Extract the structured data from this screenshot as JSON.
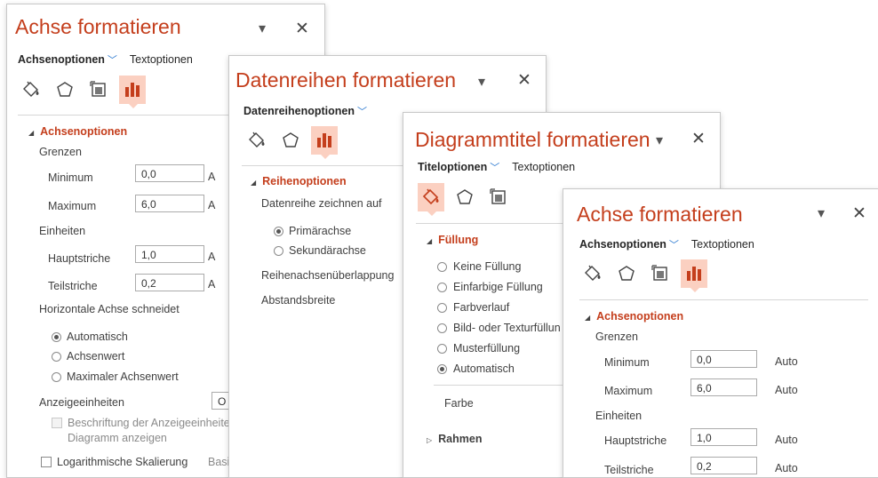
{
  "p1": {
    "title": "Achse formatieren",
    "tab_active": "Achsenoptionen",
    "tab_other": "Textoptionen",
    "section": "Achsenoptionen",
    "grenzen": "Grenzen",
    "minimum_label": "Minimum",
    "minimum_value": "0,0",
    "maximum_label": "Maximum",
    "maximum_value": "6,0",
    "auto_cut": "A",
    "einheiten": "Einheiten",
    "haupt_label": "Hauptstriche",
    "haupt_value": "1,0",
    "teil_label": "Teilstriche",
    "teil_value": "0,2",
    "schneidet": "Horizontale Achse schneidet",
    "radio_auto": "Automatisch",
    "radio_wert": "Achsenwert",
    "radio_max": "Maximaler Achsenwert",
    "anzeige": "Anzeigeeinheiten",
    "anzeige_value": "O",
    "beschriftung_1": "Beschriftung der Anzeigeeinheite",
    "beschriftung_2": "Diagramm anzeigen",
    "log": "Logarithmische Skalierung",
    "basis": "Basis"
  },
  "p2": {
    "title": "Datenreihen formatieren",
    "tab_active": "Datenreihenoptionen",
    "section": "Reihenoptionen",
    "zeichnen": "Datenreihe zeichnen auf",
    "primaer": "Primärachse",
    "sekundaer": "Sekundärachse",
    "ueberlappung": "Reihenachsenüberlappung",
    "abstand": "Abstandsbreite"
  },
  "p3": {
    "title": "Diagrammtitel formatieren",
    "tab_active": "Titeloptionen",
    "tab_other": "Textoptionen",
    "fuellung": "Füllung",
    "keine": "Keine Füllung",
    "einfarbig": "Einfarbige Füllung",
    "verlauf": "Farbverlauf",
    "bild": "Bild- oder Texturfüllun",
    "muster": "Musterfüllung",
    "automatisch": "Automatisch",
    "farbe": "Farbe",
    "rahmen": "Rahmen"
  },
  "p4": {
    "title": "Achse formatieren",
    "tab_active": "Achsenoptionen",
    "tab_other": "Textoptionen",
    "section": "Achsenoptionen",
    "grenzen": "Grenzen",
    "minimum_label": "Minimum",
    "minimum_value": "0,0",
    "maximum_label": "Maximum",
    "maximum_value": "6,0",
    "auto": "Auto",
    "einheiten": "Einheiten",
    "haupt_label": "Hauptstriche",
    "haupt_value": "1,0",
    "teil_label": "Teilstriche",
    "teil_value": "0,2"
  },
  "controls": {
    "dropdown_glyph": "▾",
    "close_glyph": "✕"
  },
  "colors": {
    "accent": "#c43e1c",
    "selected_bg": "#fbd0c1",
    "link_blue": "#2b79d0"
  }
}
